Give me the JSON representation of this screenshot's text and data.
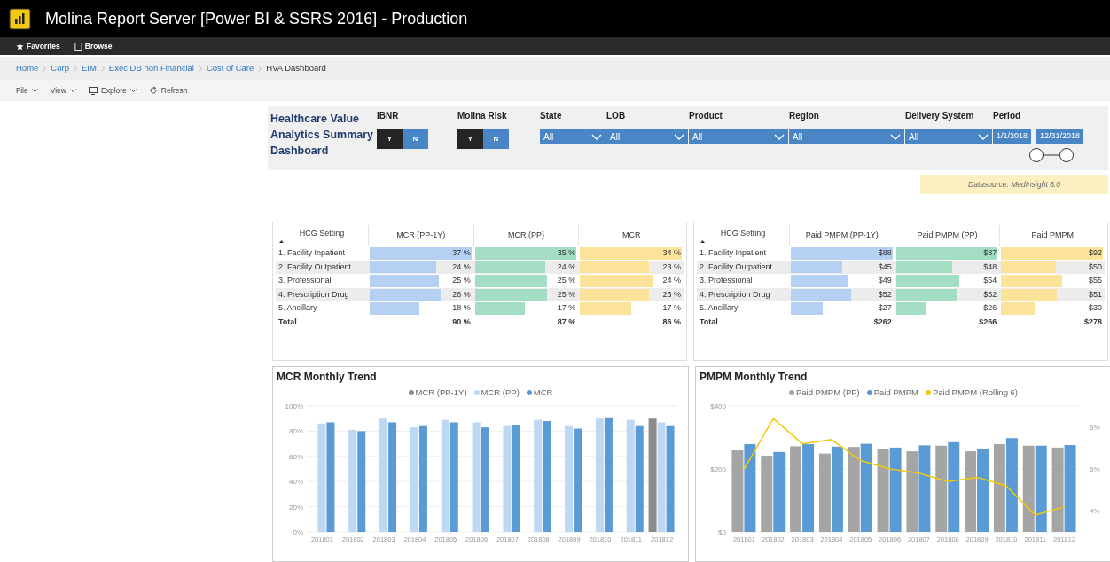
{
  "app": {
    "title": "Molina Report Server [Power BI & SSRS 2016] - Production"
  },
  "nav": [
    {
      "label": "Favorites",
      "kind": "star"
    },
    {
      "label": "Browse",
      "kind": "square"
    }
  ],
  "breadcrumb": [
    {
      "label": "Home",
      "selected": false
    },
    {
      "label": "Corp",
      "selected": false
    },
    {
      "label": "EIM",
      "selected": false
    },
    {
      "label": "Exec DB non Financial",
      "selected": false
    },
    {
      "label": "Cost of Care",
      "selected": false
    },
    {
      "label": "HVA Dashboard",
      "selected": true
    }
  ],
  "toolbar": [
    {
      "label": "File",
      "kind": "menu"
    },
    {
      "label": "View",
      "kind": "menu"
    },
    {
      "label": "Explore",
      "kind": "explore"
    },
    {
      "label": "Refresh",
      "kind": "refresh"
    }
  ],
  "dashboard": {
    "title": "Healthcare Value Analytics Summary Dashboard",
    "filters": [
      {
        "kind": "toggle",
        "label": "IBNR",
        "options": [
          {
            "label": "Y",
            "selected": false
          },
          {
            "label": "N",
            "selected": true
          }
        ]
      },
      {
        "kind": "toggle",
        "label": "Molina Risk",
        "options": [
          {
            "label": "Y",
            "selected": false
          },
          {
            "label": "N",
            "selected": true
          }
        ]
      },
      {
        "kind": "dropdown",
        "label": "State",
        "value": "All"
      },
      {
        "kind": "dropdown",
        "label": "LOB",
        "value": "All"
      },
      {
        "kind": "dropdown",
        "label": "Product",
        "value": "All"
      },
      {
        "kind": "dropdown",
        "label": "Region",
        "value": "All"
      },
      {
        "kind": "dropdown",
        "label": "Delivery System",
        "value": "All"
      },
      {
        "kind": "date-range",
        "label": "Period",
        "start": "1/1/2018",
        "end": "12/31/2018",
        "thumbs": [
          {
            "level": 0
          },
          {
            "level": 1
          }
        ]
      }
    ],
    "datasource": "Datasource: MedInsight 8.0",
    "tables": [
      {
        "columns": [
          "HCG Setting",
          "MCR (PP-1Y)",
          "MCR (PP)",
          "MCR"
        ],
        "rows": [
          {
            "label": "1. Facility Inpatient",
            "cells": [
              {
                "value": "37 %",
                "level": 1
              },
              {
                "value": "35 %",
                "level": 1
              },
              {
                "value": "34 %",
                "level": 1
              }
            ]
          },
          {
            "label": "2. Facility Outpatient",
            "cells": [
              {
                "value": "24 %",
                "level": 0.65
              },
              {
                "value": "24 %",
                "level": 0.69
              },
              {
                "value": "23 %",
                "level": 0.68
              }
            ]
          },
          {
            "label": "3. Professional",
            "cells": [
              {
                "value": "25 %",
                "level": 0.68
              },
              {
                "value": "25 %",
                "level": 0.71
              },
              {
                "value": "24 %",
                "level": 0.71
              }
            ]
          },
          {
            "label": "4. Prescription Drug",
            "cells": [
              {
                "value": "26 %",
                "level": 0.7
              },
              {
                "value": "25 %",
                "level": 0.71
              },
              {
                "value": "23 %",
                "level": 0.68
              }
            ]
          },
          {
            "label": "5. Ancillary",
            "cells": [
              {
                "value": "18 %",
                "level": 0.49
              },
              {
                "value": "17 %",
                "level": 0.49
              },
              {
                "value": "17 %",
                "level": 0.5
              }
            ]
          }
        ],
        "total": {
          "label": "Total",
          "cells": [
            "90 %",
            "87 %",
            "86 %"
          ]
        }
      },
      {
        "columns": [
          "HCG Setting",
          "Paid PMPM (PP-1Y)",
          "Paid PMPM (PP)",
          "Paid PMPM"
        ],
        "rows": [
          {
            "label": "1. Facility Inpatient",
            "cells": [
              {
                "value": "$88",
                "level": 1
              },
              {
                "value": "$87",
                "level": 1
              },
              {
                "value": "$92",
                "level": 1
              }
            ]
          },
          {
            "label": "2. Facility Outpatient",
            "cells": [
              {
                "value": "$45",
                "level": 0.51
              },
              {
                "value": "$48",
                "level": 0.55
              },
              {
                "value": "$50",
                "level": 0.54
              }
            ]
          },
          {
            "label": "3. Professional",
            "cells": [
              {
                "value": "$49",
                "level": 0.56
              },
              {
                "value": "$54",
                "level": 0.62
              },
              {
                "value": "$55",
                "level": 0.6
              }
            ]
          },
          {
            "label": "4. Prescription Drug",
            "cells": [
              {
                "value": "$52",
                "level": 0.59
              },
              {
                "value": "$52",
                "level": 0.6
              },
              {
                "value": "$51",
                "level": 0.55
              }
            ]
          },
          {
            "label": "5. Ancillary",
            "cells": [
              {
                "value": "$27",
                "level": 0.31
              },
              {
                "value": "$26",
                "level": 0.3
              },
              {
                "value": "$30",
                "level": 0.33
              }
            ]
          }
        ],
        "total": {
          "label": "Total",
          "cells": [
            "$262",
            "$266",
            "$278"
          ]
        }
      }
    ],
    "charts": [
      {
        "chart_data": {
          "type": "bar",
          "grid": true,
          "title": "MCR Monthly Trend",
          "categories": [
            "201801",
            "201802",
            "201803",
            "201804",
            "201805",
            "201806",
            "201807",
            "201808",
            "201809",
            "201810",
            "201811",
            "201812"
          ],
          "ylim": [
            0,
            100
          ],
          "yticks": [
            {
              "value": 0,
              "label": "0%"
            },
            {
              "value": 20,
              "label": "20%"
            },
            {
              "value": 40,
              "label": "40%"
            },
            {
              "value": 60,
              "label": "60%"
            },
            {
              "value": 80,
              "label": "80%"
            },
            {
              "value": 100,
              "label": "100%"
            }
          ],
          "series": [
            {
              "name": "MCR (PP-1Y)",
              "color": "#8c8c8c",
              "type": "bar",
              "values": [
                null,
                null,
                null,
                null,
                null,
                null,
                null,
                null,
                null,
                null,
                null,
                90
              ]
            },
            {
              "name": "MCR (PP)",
              "color": "#bcd8f2",
              "type": "bar",
              "values": [
                86,
                81,
                90,
                83,
                89,
                87,
                84,
                89,
                84,
                90,
                89,
                87
              ]
            },
            {
              "name": "MCR",
              "color": "#5b9bd5",
              "type": "bar",
              "values": [
                87,
                80,
                87,
                84,
                87,
                83,
                85,
                88,
                82,
                91,
                84,
                84
              ]
            }
          ]
        }
      },
      {
        "chart_data": {
          "type": "bar",
          "grid": true,
          "title": "PMPM Monthly Trend",
          "categories": [
            "201801",
            "201802",
            "201803",
            "201804",
            "201805",
            "201806",
            "201807",
            "201808",
            "201809",
            "201810",
            "201811",
            "201812"
          ],
          "ylim": [
            0,
            400
          ],
          "yticks": [
            {
              "value": 0,
              "label": "$0"
            },
            {
              "value": 200,
              "label": "$200"
            },
            {
              "value": 400,
              "label": "$400"
            }
          ],
          "y2lim": [
            3.5,
            6.5
          ],
          "y2ticks": [
            {
              "value": 4,
              "label": "4%"
            },
            {
              "value": 5,
              "label": "5%"
            },
            {
              "value": 6,
              "label": "6%"
            }
          ],
          "series": [
            {
              "name": "Paid PMPM (PP)",
              "color": "#a5a5a5",
              "type": "bar",
              "values": [
                259,
                242,
                272,
                249,
                270,
                263,
                256,
                274,
                256,
                279,
                274,
                268
              ]
            },
            {
              "name": "Paid PMPM",
              "color": "#5b9bd5",
              "type": "bar",
              "values": [
                279,
                254,
                279,
                271,
                280,
                268,
                275,
                285,
                265,
                298,
                274,
                276
              ]
            },
            {
              "name": "Paid PMPM (Rolling 6)",
              "color": "#f2c80f",
              "type": "line",
              "axis": "y2",
              "values": [
                5.0,
                6.2,
                5.6,
                5.7,
                5.2,
                5.0,
                4.9,
                4.7,
                4.8,
                4.6,
                3.9,
                4.1
              ]
            }
          ]
        }
      }
    ]
  }
}
